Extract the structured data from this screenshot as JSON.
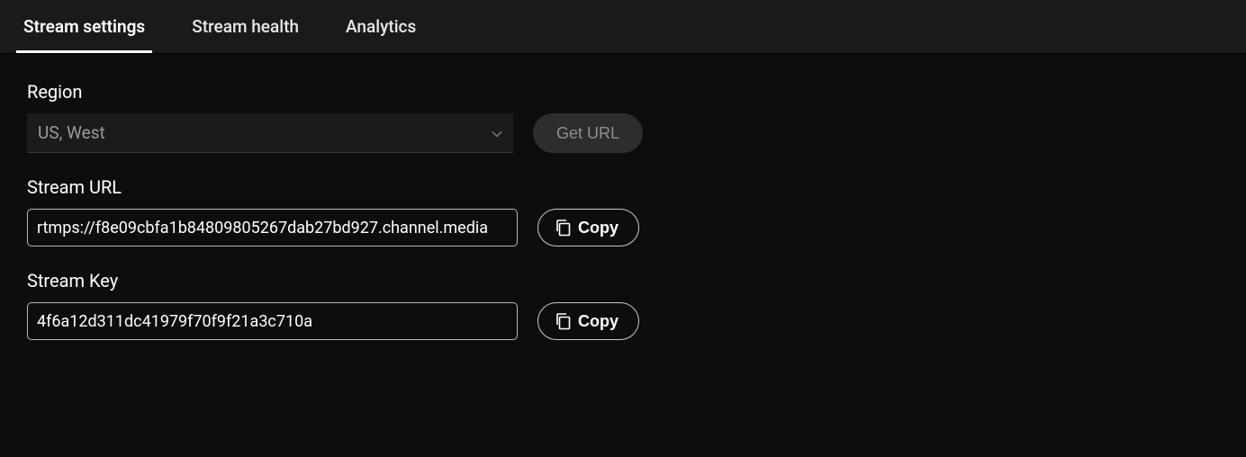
{
  "tabs": {
    "settings": "Stream settings",
    "health": "Stream health",
    "analytics": "Analytics"
  },
  "region": {
    "label": "Region",
    "selected": "US, West",
    "get_url_label": "Get URL"
  },
  "stream_url": {
    "label": "Stream URL",
    "value": "rtmps://f8e09cbfa1b84809805267dab27bd927.channel.media",
    "copy_label": "Copy"
  },
  "stream_key": {
    "label": "Stream Key",
    "value": "4f6a12d311dc41979f70f9f21a3c710a",
    "copy_label": "Copy"
  }
}
